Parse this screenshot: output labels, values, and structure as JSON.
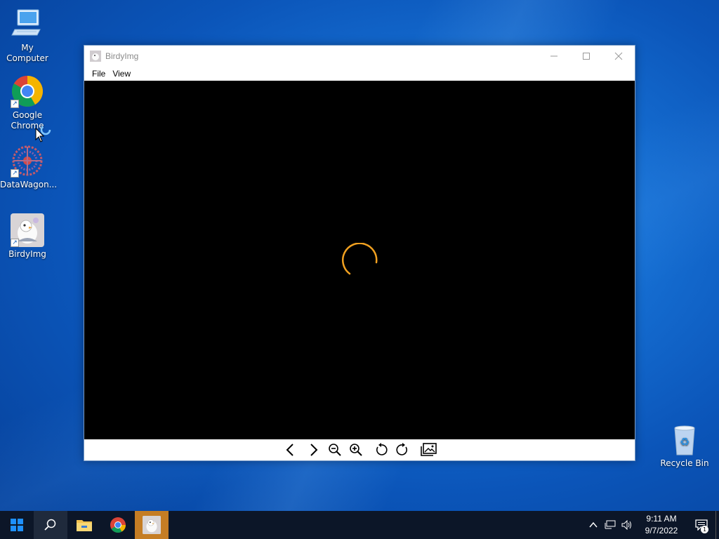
{
  "desktop": {
    "icons": [
      {
        "label": "My Computer"
      },
      {
        "label": "Google Chrome"
      },
      {
        "label": "DataWagon..."
      },
      {
        "label": "BirdyImg"
      },
      {
        "label": "Recycle Bin"
      }
    ]
  },
  "window": {
    "title": "BirdyImg",
    "menu": [
      "File",
      "View"
    ]
  },
  "taskbar": {
    "clock": {
      "time": "9:11 AM",
      "date": "9/7/2022"
    },
    "notification_count": "1"
  },
  "colors": {
    "spinner": "#f0a020",
    "taskbar_active": "#c57d24"
  }
}
